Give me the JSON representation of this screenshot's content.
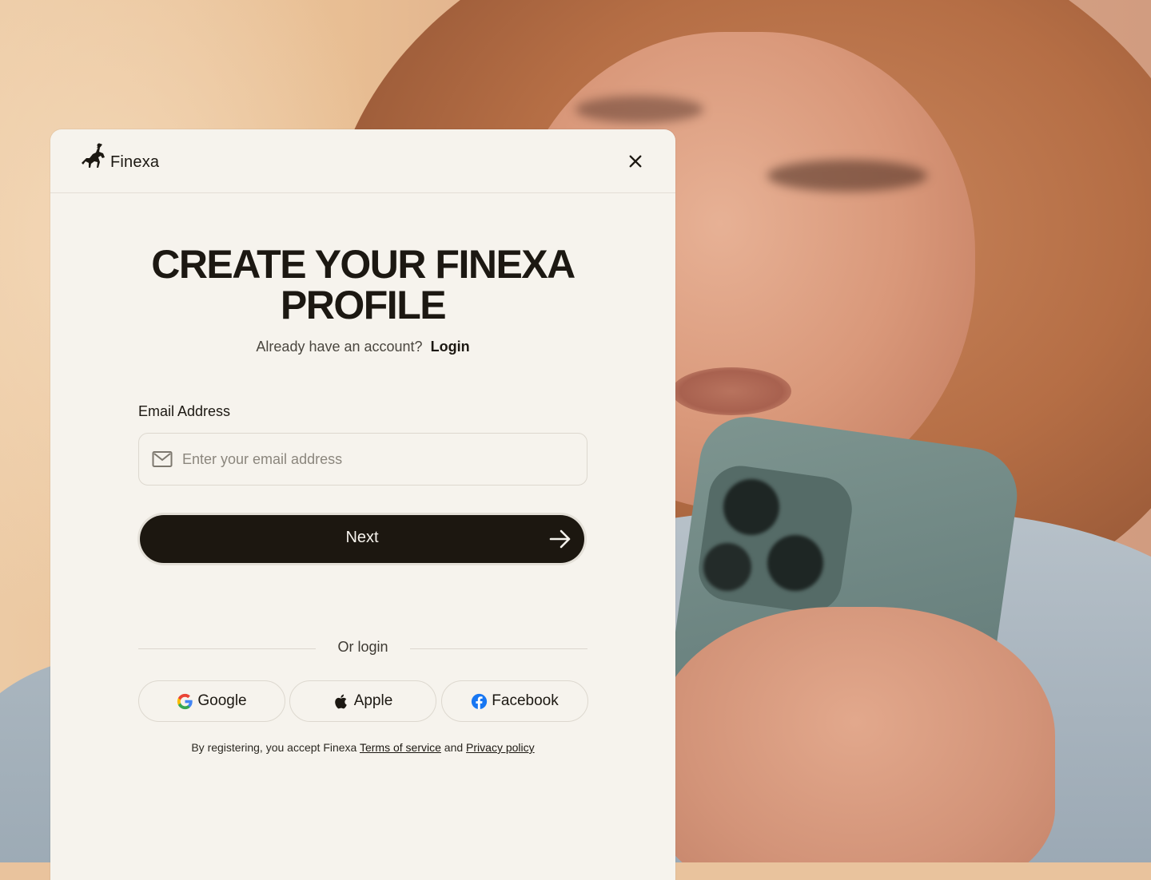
{
  "brand": {
    "name": "Finexa"
  },
  "modal": {
    "title_line1": "CREATE YOUR FINEXA",
    "title_line2": "PROFILE",
    "subtitle": "Already have an account?",
    "login_link": "Login"
  },
  "form": {
    "email_label": "Email Address",
    "email_placeholder": "Enter your email address",
    "email_value": "",
    "next_label": "Next"
  },
  "social": {
    "divider_text": "Or login",
    "buttons": [
      {
        "label": "Google",
        "icon": "google-icon"
      },
      {
        "label": "Apple",
        "icon": "apple-icon"
      },
      {
        "label": "Facebook",
        "icon": "facebook-icon"
      }
    ]
  },
  "legal": {
    "prefix": "By registering, you accept Finexa",
    "terms": "Terms of service",
    "joiner": "and",
    "privacy": "Privacy policy"
  },
  "colors": {
    "card_bg": "#f6f3ed",
    "primary_button": "#1c1710",
    "text_dark": "#1c1812",
    "facebook_blue": "#1877f2"
  }
}
